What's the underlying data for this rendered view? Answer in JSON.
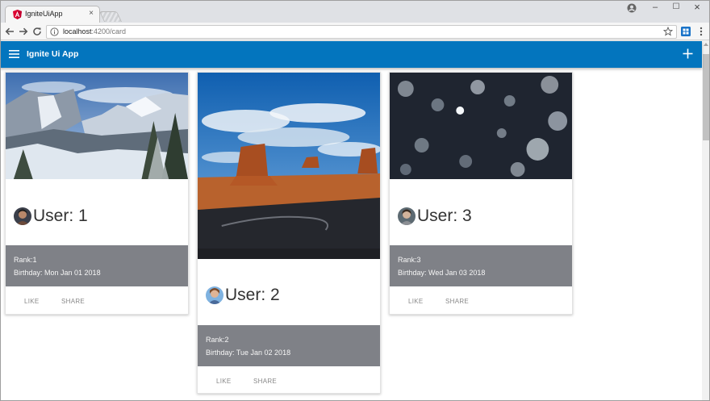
{
  "browser": {
    "tab_title": "IgniteUiApp",
    "tab_close": "×",
    "window_minimize": "–",
    "window_maximize": "☐",
    "window_close": "×",
    "url_host": "localhost",
    "url_path": ":4200/card"
  },
  "app": {
    "title": "Ignite Ui App",
    "primary_color": "#0375be"
  },
  "cards": [
    {
      "user_title": "User: 1",
      "rank": "Rank:1",
      "birthday": "Birthday: Mon Jan 01 2018",
      "like": "LIKE",
      "share": "SHARE",
      "image": "snowy-valley-landscape",
      "avatar": "user-avatar"
    },
    {
      "user_title": "User: 2",
      "rank": "Rank:2",
      "birthday": "Birthday: Tue Jan 02 2018",
      "like": "LIKE",
      "share": "SHARE",
      "image": "desert-buttes-landscape",
      "avatar": "user-avatar"
    },
    {
      "user_title": "User: 3",
      "rank": "Rank:3",
      "birthday": "Birthday: Wed Jan 03 2018",
      "like": "LIKE",
      "share": "SHARE",
      "image": "snowy-forest-aerial",
      "avatar": "user-avatar"
    }
  ],
  "colors": {
    "details_background": "#7f8187",
    "app_bar": "#0375be"
  }
}
